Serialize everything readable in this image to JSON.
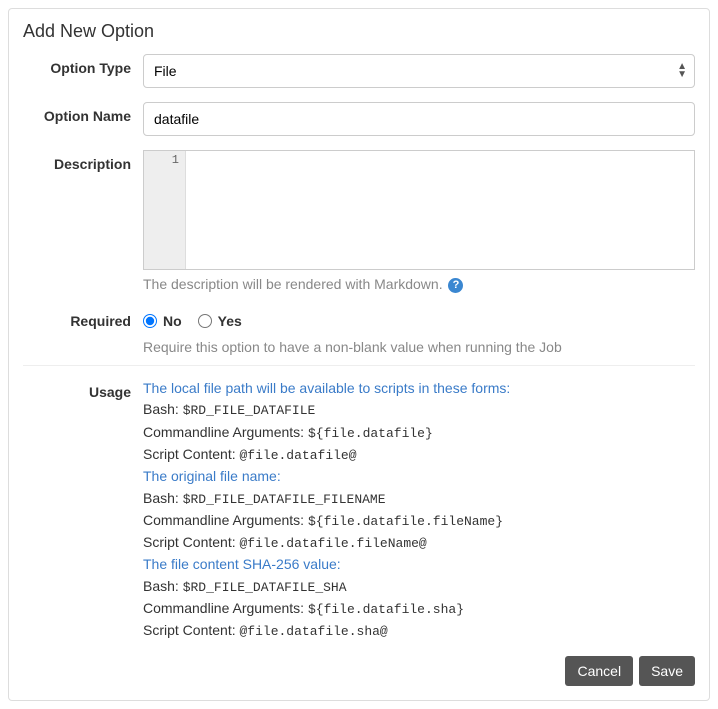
{
  "title": "Add New Option",
  "labels": {
    "optionType": "Option Type",
    "optionName": "Option Name",
    "description": "Description",
    "required": "Required",
    "usage": "Usage"
  },
  "optionType": {
    "selected": "File"
  },
  "optionName": {
    "value": "datafile"
  },
  "description": {
    "gutter": "1",
    "value": "",
    "help": "The description will be rendered with Markdown."
  },
  "required": {
    "no": "No",
    "yes": "Yes",
    "selected": "No",
    "help": "Require this option to have a non-blank value when running the Job"
  },
  "usage": {
    "section1": {
      "heading": "The local file path will be available to scripts in these forms:",
      "bashLabel": "Bash:",
      "bashVal": "$RD_FILE_DATAFILE",
      "argsLabel": "Commandline Arguments:",
      "argsVal": "${file.datafile}",
      "scriptLabel": "Script Content:",
      "scriptVal": "@file.datafile@"
    },
    "section2": {
      "heading": "The original file name:",
      "bashLabel": "Bash:",
      "bashVal": "$RD_FILE_DATAFILE_FILENAME",
      "argsLabel": "Commandline Arguments:",
      "argsVal": "${file.datafile.fileName}",
      "scriptLabel": "Script Content:",
      "scriptVal": "@file.datafile.fileName@"
    },
    "section3": {
      "heading": "The file content SHA-256 value:",
      "bashLabel": "Bash:",
      "bashVal": "$RD_FILE_DATAFILE_SHA",
      "argsLabel": "Commandline Arguments:",
      "argsVal": "${file.datafile.sha}",
      "scriptLabel": "Script Content:",
      "scriptVal": "@file.datafile.sha@"
    }
  },
  "buttons": {
    "cancel": "Cancel",
    "save": "Save"
  }
}
